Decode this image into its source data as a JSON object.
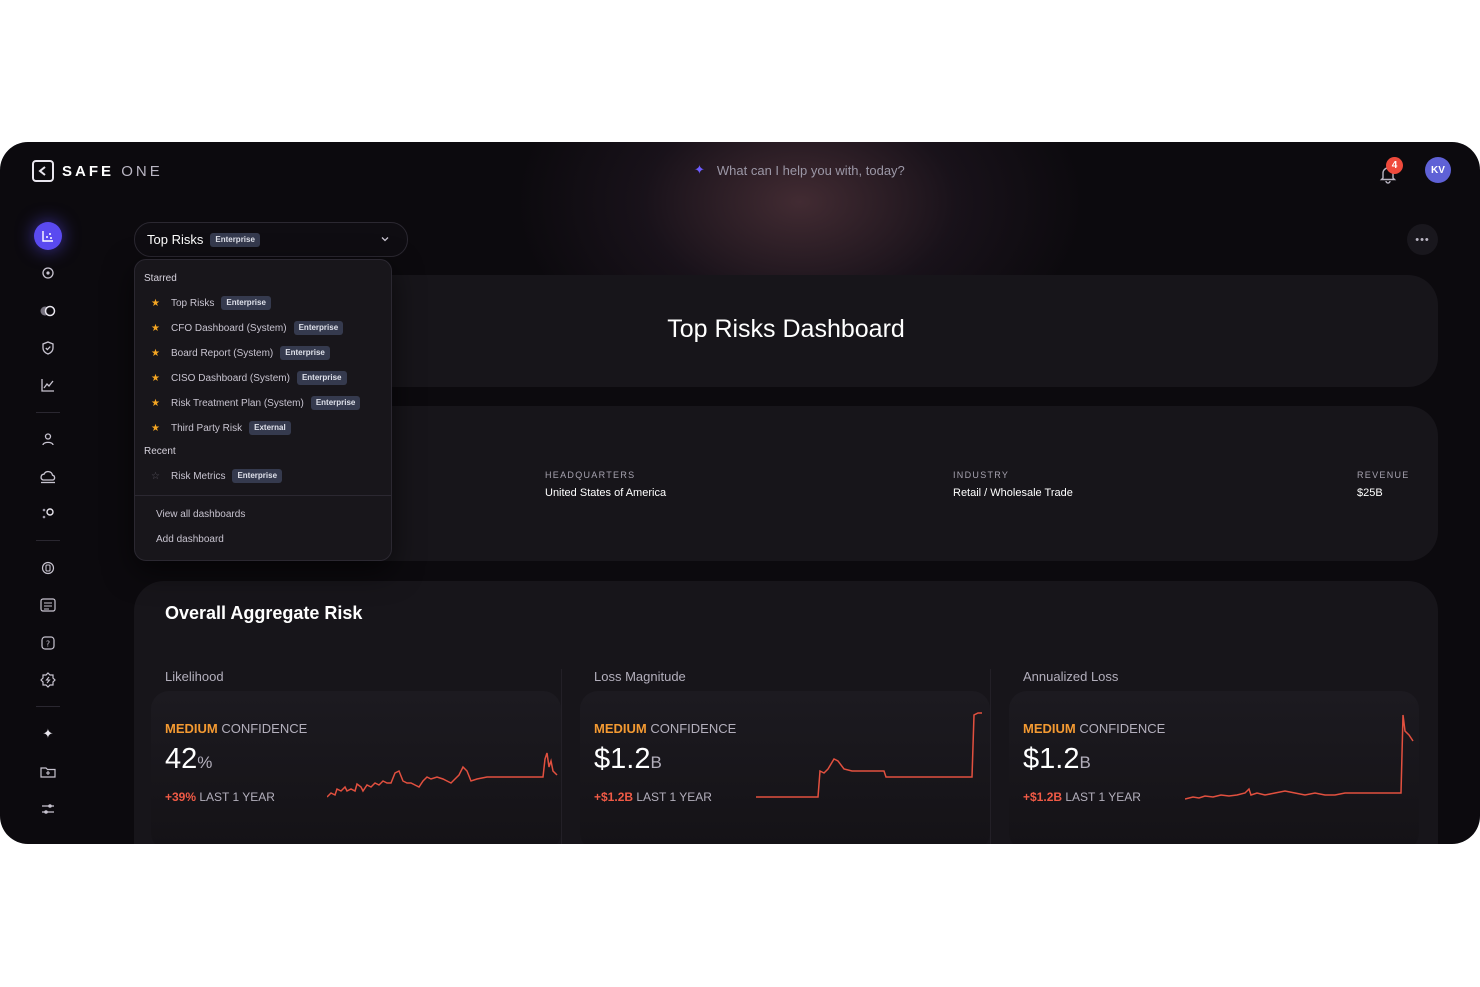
{
  "brand": {
    "name_bold": "SAFE",
    "name_light": "ONE"
  },
  "assistant": {
    "placeholder": "What can I help you with, today?"
  },
  "notifications": {
    "count": "4"
  },
  "user": {
    "initials": "KV"
  },
  "dashboard_selector": {
    "title": "Top Risks",
    "tag": "Enterprise"
  },
  "dropdown": {
    "starred_heading": "Starred",
    "starred": [
      {
        "label": "Top Risks",
        "tag": "Enterprise"
      },
      {
        "label": "CFO Dashboard (System)",
        "tag": "Enterprise"
      },
      {
        "label": "Board Report (System)",
        "tag": "Enterprise"
      },
      {
        "label": "CISO Dashboard (System)",
        "tag": "Enterprise"
      },
      {
        "label": "Risk Treatment Plan (System)",
        "tag": "Enterprise"
      },
      {
        "label": "Third Party Risk",
        "tag": "External"
      }
    ],
    "recent_heading": "Recent",
    "recent": [
      {
        "label": "Risk Metrics",
        "tag": "Enterprise"
      }
    ],
    "view_all": "View all dashboards",
    "add": "Add dashboard"
  },
  "page_title": "Top Risks Dashboard",
  "company": {
    "headquarters_label": "HEADQUARTERS",
    "headquarters": "United States of America",
    "industry_label": "INDUSTRY",
    "industry": "Retail / Wholesale Trade",
    "revenue_label": "REVENUE",
    "revenue": "$25B"
  },
  "aggregate": {
    "title": "Overall Aggregate Risk",
    "metrics": [
      {
        "label": "Likelihood",
        "level": "MEDIUM",
        "confidence": "CONFIDENCE",
        "value": "42",
        "unit": "%",
        "delta": "+39%",
        "period": "LAST 1 YEAR"
      },
      {
        "label": "Loss Magnitude",
        "level": "MEDIUM",
        "confidence": "CONFIDENCE",
        "value": "$1.2",
        "unit": "B",
        "delta": "+$1.2B",
        "period": "LAST 1 YEAR"
      },
      {
        "label": "Annualized Loss",
        "level": "MEDIUM",
        "confidence": "CONFIDENCE",
        "value": "$1.2",
        "unit": "B",
        "delta": "+$1.2B",
        "period": "LAST 1 YEAR"
      }
    ]
  },
  "colors": {
    "accent": "#5a4af0",
    "warning": "#f49a32",
    "negative": "#ef5a46",
    "sparkline": "#e2503f"
  },
  "icons": [
    "dashboard-icon",
    "target-icon",
    "toggle-icon",
    "shield-check-icon",
    "line-chart-icon",
    "user-icon",
    "cloud-icon",
    "nodes-icon",
    "device-icon",
    "list-icon",
    "help-icon",
    "settings-icon",
    "sparkle-icon",
    "folder-icon",
    "sliders-icon"
  ]
}
